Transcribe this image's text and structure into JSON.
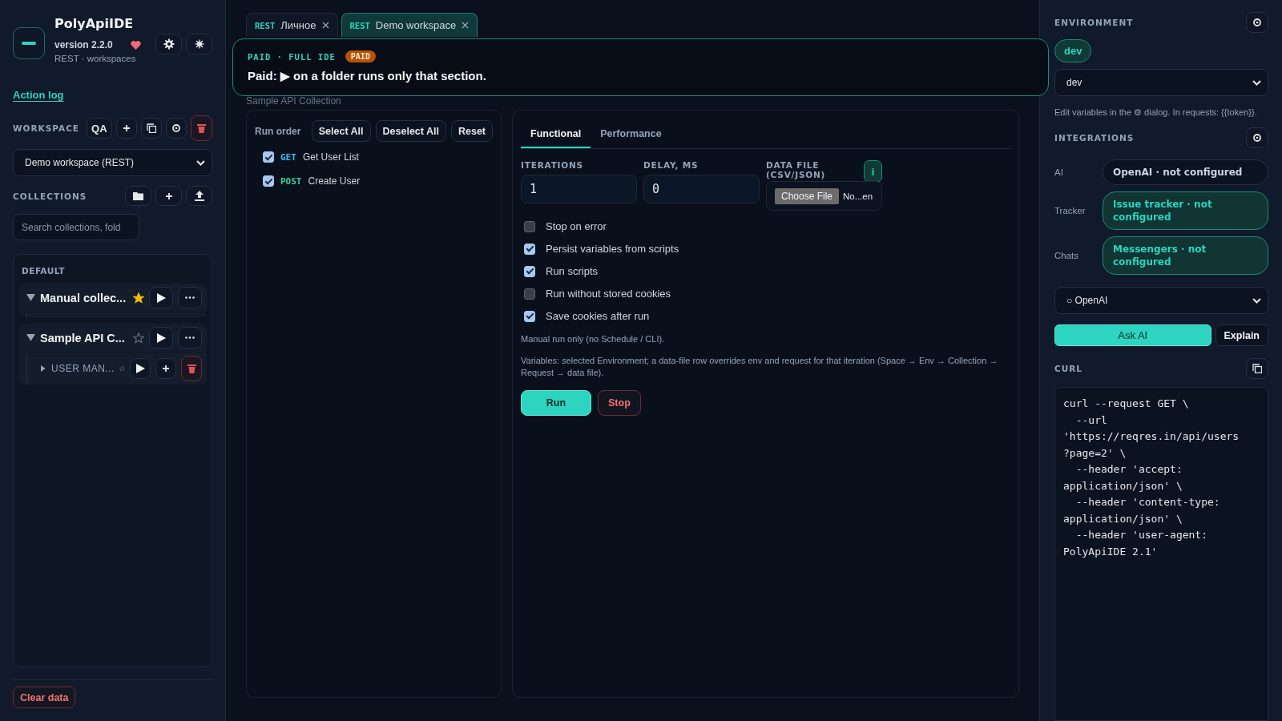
{
  "app": {
    "name": "PolyApiIDE",
    "version": "version 2.2.0",
    "subtitle": "REST · workspaces"
  },
  "action_log": "Action log",
  "workspace": {
    "label": "WORKSPACE",
    "badge": "QA",
    "selected": "Demo workspace (REST)"
  },
  "collections": {
    "label": "COLLECTIONS",
    "search_placeholder": "Search collections, fold",
    "group": "DEFAULT",
    "items": [
      {
        "name": "Manual collec...",
        "starred": true,
        "expanded": true
      },
      {
        "name": "Sample API C...",
        "starred": false,
        "expanded": true,
        "children": [
          {
            "name": "USER MAN...",
            "starred": false,
            "expanded": false
          }
        ]
      }
    ]
  },
  "clear_data": "Clear data",
  "tabs": [
    {
      "protocol": "REST",
      "label": "Личное",
      "selected": false
    },
    {
      "protocol": "REST",
      "label": "Demo workspace",
      "selected": true
    }
  ],
  "toast": {
    "eyebrow": "PAID · FULL IDE",
    "badge": "PAID",
    "message": "Paid: ▶ on a folder runs only that section."
  },
  "collection_header": {
    "title": "Sample API Collection"
  },
  "run_order": {
    "label": "Run order",
    "buttons": [
      "Select All",
      "Deselect All",
      "Reset"
    ],
    "requests": [
      {
        "method": "GET",
        "color": "#38bdf8",
        "name": "Get User List",
        "checked": true
      },
      {
        "method": "POST",
        "color": "#34d399",
        "name": "Create User",
        "checked": true
      }
    ]
  },
  "runner": {
    "tabs": [
      {
        "label": "Functional",
        "selected": true
      },
      {
        "label": "Performance",
        "selected": false
      }
    ],
    "fields": [
      {
        "label": "ITERATIONS",
        "value": "1"
      },
      {
        "label": "DELAY, MS",
        "value": "0"
      }
    ],
    "data_file": {
      "label": "DATA FILE (CSV/JSON)",
      "info": "i",
      "button": "Choose File",
      "file_name": "No...en"
    },
    "options": [
      {
        "label": "Stop on error",
        "checked": false
      },
      {
        "label": "Persist variables from scripts",
        "checked": true
      },
      {
        "label": "Run scripts",
        "checked": true
      },
      {
        "label": "Run without stored cookies",
        "checked": false
      },
      {
        "label": "Save cookies after run",
        "checked": true
      }
    ],
    "notes": [
      "Manual run only (no Schedule / CLI).",
      "Variables: selected Environment; a data-file row overrides env and request for that iteration (Space → Env → Collection → Request → data file)."
    ],
    "run": "Run",
    "stop": "Stop"
  },
  "environment": {
    "label": "ENVIRONMENT",
    "chip": "dev",
    "selected": "dev",
    "hint": "Edit variables in the ⚙ dialog. In requests: {{token}}."
  },
  "integrations": {
    "label": "INTEGRATIONS",
    "rows": [
      {
        "label": "AI",
        "value": "OpenAI · not configured",
        "highlighted": false
      },
      {
        "label": "Tracker",
        "value": "Issue tracker · not configured",
        "highlighted": true
      },
      {
        "label": "Chats",
        "value": "Messengers · not configured",
        "highlighted": true
      }
    ],
    "provider": "○ OpenAI",
    "ask": "Ask AI",
    "explain": "Explain"
  },
  "curl": {
    "label": "CURL",
    "code": "curl --request GET \\\n  --url\n'https://reqres.in/api/users\n?page=2' \\\n  --header 'accept:\napplication/json' \\\n  --header 'content-type:\napplication/json' \\\n  --header 'user-agent:\nPolyApiIDE 2.1'"
  }
}
